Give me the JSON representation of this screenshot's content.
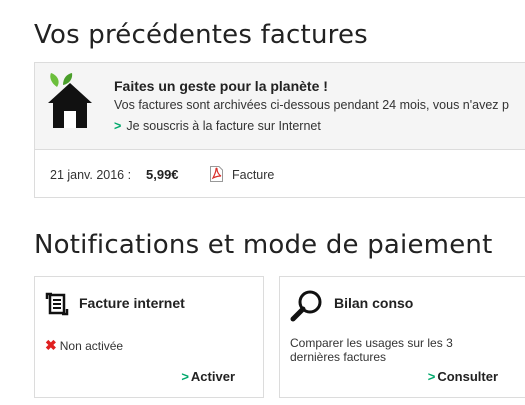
{
  "invoices": {
    "title": "Vos précédentes factures",
    "promo": {
      "title": "Faites un geste pour la planète !",
      "text": "Vos factures sont archivées ci-dessous pendant 24 mois, vous n'avez p",
      "link_chevron": ">",
      "link_label": "Je souscris à la facture sur Internet",
      "icon": "eco-house-icon"
    },
    "rows": [
      {
        "date": "21 janv. 2016 :",
        "amount": "5,99€",
        "link_label": "Facture",
        "icon": "pdf-icon"
      }
    ]
  },
  "notifications": {
    "title": "Notifications et mode de paiement",
    "cards": [
      {
        "title": "Facture internet",
        "icon": "invoice-sync-icon",
        "status_icon": "✖",
        "status": "Non activée",
        "action_chevron": ">",
        "action": "Activer"
      },
      {
        "title": "Bilan conso",
        "icon": "magnifier-icon",
        "description": "Comparer les usages sur les 3 dernières factures",
        "action_chevron": ">",
        "action": "Consulter"
      }
    ]
  },
  "colors": {
    "accent_green": "#00a86b",
    "leaf_green": "#6cbf3c",
    "error_red": "#e02020",
    "pdf_red": "#d9302c"
  }
}
